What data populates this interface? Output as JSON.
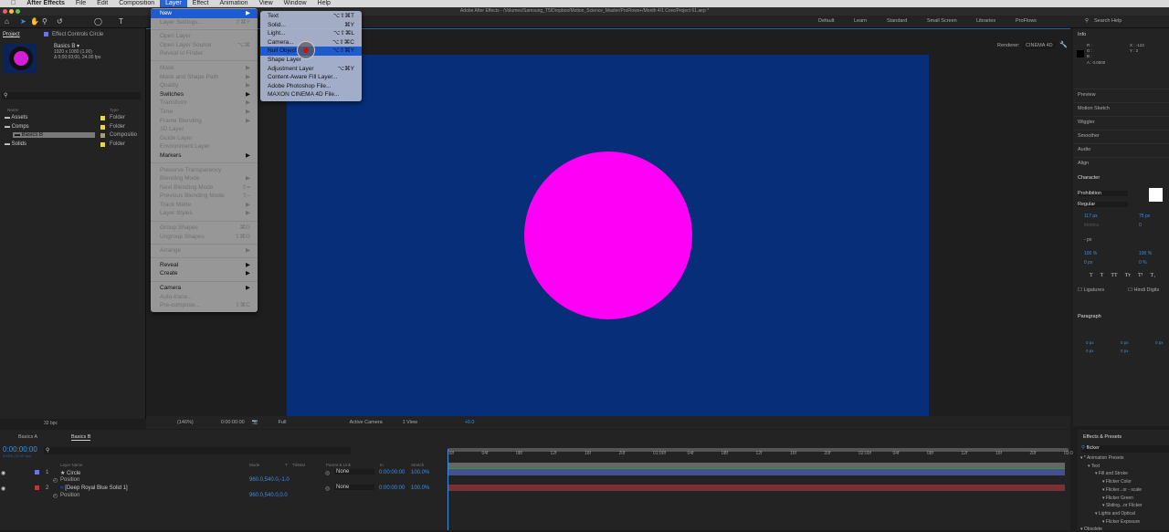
{
  "menubar": {
    "apple": "",
    "app": "After Effects",
    "items": [
      "File",
      "Edit",
      "Composition",
      "Layer",
      "Effect",
      "Animation",
      "View",
      "Window",
      "Help"
    ]
  },
  "title": "Adobe After Effects - /Volumes/Samsung_T5/Dropbox/Motion_Science_Master/ProFlows+/Month 4/1 Core/Project 61.aep *",
  "workspaces": [
    "Default",
    "Learn",
    "Standard",
    "Small Screen",
    "Libraries",
    "ProFlows"
  ],
  "search_help": "Search Help",
  "project": {
    "tab": "Project",
    "effect_controls": "Effect Controls Circle",
    "comp_name": "Basics B ▾",
    "comp_info1": "1920 x 1080 (1.00)",
    "comp_info2": "Δ 0;00;03;00, 24.00 fps",
    "col_name": "Name",
    "col_type": "Type",
    "items": [
      {
        "name": "Assets",
        "type": "Folder",
        "color": "#e6d84a"
      },
      {
        "name": "Comps",
        "type": "Folder",
        "color": "#e6d84a"
      },
      {
        "name": "Basics B",
        "type": "Compositio",
        "color": "#a89c80"
      },
      {
        "name": "Solids",
        "type": "Folder",
        "color": "#e6d84a"
      }
    ],
    "bpc": "32 bpc"
  },
  "renderer": {
    "label": "Renderer:",
    "value": "CINEMA 4D"
  },
  "layer_menu": [
    {
      "label": "New",
      "sc": "▶",
      "state": "hl"
    },
    {
      "label": "Layer Settings...",
      "sc": "⇧⌘Y",
      "state": "dis"
    },
    {
      "sep": true
    },
    {
      "label": "Open Layer",
      "sc": "",
      "state": "dis"
    },
    {
      "label": "Open Layer Source",
      "sc": "⌥⌘",
      "state": "dis"
    },
    {
      "label": "Reveal in Finder",
      "sc": "",
      "state": "dis"
    },
    {
      "sep": true
    },
    {
      "label": "Mask",
      "sc": "▶",
      "state": "dis"
    },
    {
      "label": "Mask and Shape Path",
      "sc": "▶",
      "state": "dis"
    },
    {
      "label": "Quality",
      "sc": "▶",
      "state": "dis"
    },
    {
      "label": "Switches",
      "sc": "▶",
      "state": "en"
    },
    {
      "label": "Transform",
      "sc": "▶",
      "state": "dis"
    },
    {
      "label": "Time",
      "sc": "▶",
      "state": "dis"
    },
    {
      "label": "Frame Blending",
      "sc": "▶",
      "state": "dis"
    },
    {
      "label": "3D Layer",
      "sc": "",
      "state": "dis"
    },
    {
      "label": "Guide Layer",
      "sc": "",
      "state": "dis"
    },
    {
      "label": "Environment Layer",
      "sc": "",
      "state": "dis"
    },
    {
      "label": "Markers",
      "sc": "▶",
      "state": "en"
    },
    {
      "sep": true
    },
    {
      "label": "Preserve Transparency",
      "sc": "",
      "state": "dis"
    },
    {
      "label": "Blending Mode",
      "sc": "▶",
      "state": "dis"
    },
    {
      "label": "Next Blending Mode",
      "sc": "⇧=",
      "state": "dis"
    },
    {
      "label": "Previous Blending Mode",
      "sc": "⇧–",
      "state": "dis"
    },
    {
      "label": "Track Matte",
      "sc": "▶",
      "state": "dis"
    },
    {
      "label": "Layer Styles",
      "sc": "▶",
      "state": "dis"
    },
    {
      "sep": true
    },
    {
      "label": "Group Shapes",
      "sc": "⌘G",
      "state": "dis"
    },
    {
      "label": "Ungroup Shapes",
      "sc": "⇧⌘G",
      "state": "dis"
    },
    {
      "sep": true
    },
    {
      "label": "Arrange",
      "sc": "▶",
      "state": "dis"
    },
    {
      "sep": true
    },
    {
      "label": "Reveal",
      "sc": "▶",
      "state": "en"
    },
    {
      "label": "Create",
      "sc": "▶",
      "state": "en"
    },
    {
      "sep": true
    },
    {
      "label": "Camera",
      "sc": "▶",
      "state": "en"
    },
    {
      "label": "Auto-trace...",
      "sc": "",
      "state": "dis"
    },
    {
      "label": "Pre-compose...",
      "sc": "⇧⌘C",
      "state": "dis"
    }
  ],
  "new_submenu": [
    {
      "label": "Text",
      "sc": "⌥⇧⌘T"
    },
    {
      "label": "Solid...",
      "sc": "⌘Y"
    },
    {
      "label": "Light...",
      "sc": "⌥⇧⌘L"
    },
    {
      "label": "Camera...",
      "sc": "⌥⇧⌘C"
    },
    {
      "label": "Null Object",
      "sc": "⌥⇧⌘Y",
      "state": "hl"
    },
    {
      "label": "Shape Layer",
      "sc": ""
    },
    {
      "label": "Adjustment Layer",
      "sc": "⌥⌘Y"
    },
    {
      "label": "Content-Aware Fill Layer...",
      "sc": ""
    },
    {
      "label": "Adobe Photoshop File...",
      "sc": ""
    },
    {
      "label": "MAXON CINEMA 4D File...",
      "sc": ""
    }
  ],
  "viewbar": {
    "zoom": "(146%)",
    "time": "0:00:00:00",
    "resolution": "Full",
    "camera": "Active Camera",
    "views": "1 View",
    "exposure": "+0.0"
  },
  "info": {
    "title": "Info",
    "r": "R :",
    "g": "G :",
    "b": "B :",
    "a": "A : 0.0000",
    "x": "X : -123",
    "y": "Y : 2"
  },
  "right_panels": [
    "Preview",
    "Motion Sketch",
    "Wiggler",
    "Smoother",
    "Audio",
    "Align"
  ],
  "character": {
    "title": "Character",
    "font": "Prohibition",
    "style": "Regular",
    "size": "117 px",
    "leading": "75 px",
    "kerning": "Metrics",
    "tracking": "0",
    "stroke": "- px",
    "vscale": "100 %",
    "hscale": "100 %",
    "baseline": "0 px",
    "tsume": "0 %",
    "ligatures": "Ligatures",
    "hindi": "Hindi Digits",
    "styles": [
      "T",
      "T",
      "TT",
      "Tт",
      "T¹",
      "T₁"
    ]
  },
  "paragraph": {
    "title": "Paragraph",
    "vals": [
      "0 px",
      "0 px",
      "0 px",
      "0 px",
      "0 px"
    ]
  },
  "timeline": {
    "tabs": [
      "Basics A",
      "Basics B"
    ],
    "timecode": "0:00:00:00",
    "frames": "00000 (24.00 fps)",
    "cols": {
      "name": "Layer Name",
      "mode": "Mode",
      "t": "T",
      "trkmat": "TrkMat",
      "parent": "Parent & Link",
      "in": "In",
      "stretch": "Stretch"
    },
    "layers": [
      {
        "num": "1",
        "name": "Circle",
        "color": "#6d74e6",
        "prop": "Position",
        "value": "960.0,540.0,-1.0",
        "parent": "None",
        "in": "0:00:00:00",
        "stretch": "100.0%"
      },
      {
        "num": "2",
        "name": "[Deep Royal Blue Solid 1]",
        "color": "#c0343a",
        "prop": "Position",
        "value": "960.0,540.0,0.0",
        "parent": "None",
        "in": "0:00:00:00",
        "stretch": "100.0%"
      }
    ],
    "ticks": [
      "00f",
      "04f",
      "08f",
      "12f",
      "16f",
      "20f",
      "01:00f",
      "04f",
      "08f",
      "12f",
      "16f",
      "20f",
      "02:00f",
      "04f",
      "08f",
      "12f",
      "16f",
      "20f",
      "03:0"
    ]
  },
  "effects": {
    "title": "Effects & Presets",
    "search": "flicker",
    "tree": [
      {
        "label": "* Animation Presets",
        "lvl": 0
      },
      {
        "label": "Text",
        "lvl": 1
      },
      {
        "label": "Fill and Stroke",
        "lvl": 2
      },
      {
        "label": "Flicker Color",
        "lvl": 3
      },
      {
        "label": "Flicker...or - scale",
        "lvl": 3
      },
      {
        "label": "Flicker Green",
        "lvl": 3
      },
      {
        "label": "Sliding...or Flicker",
        "lvl": 3
      },
      {
        "label": "Lights and Optical",
        "lvl": 2
      },
      {
        "label": "Flicker Exposure",
        "lvl": 3
      },
      {
        "label": "Obsolete",
        "lvl": 0
      }
    ]
  }
}
